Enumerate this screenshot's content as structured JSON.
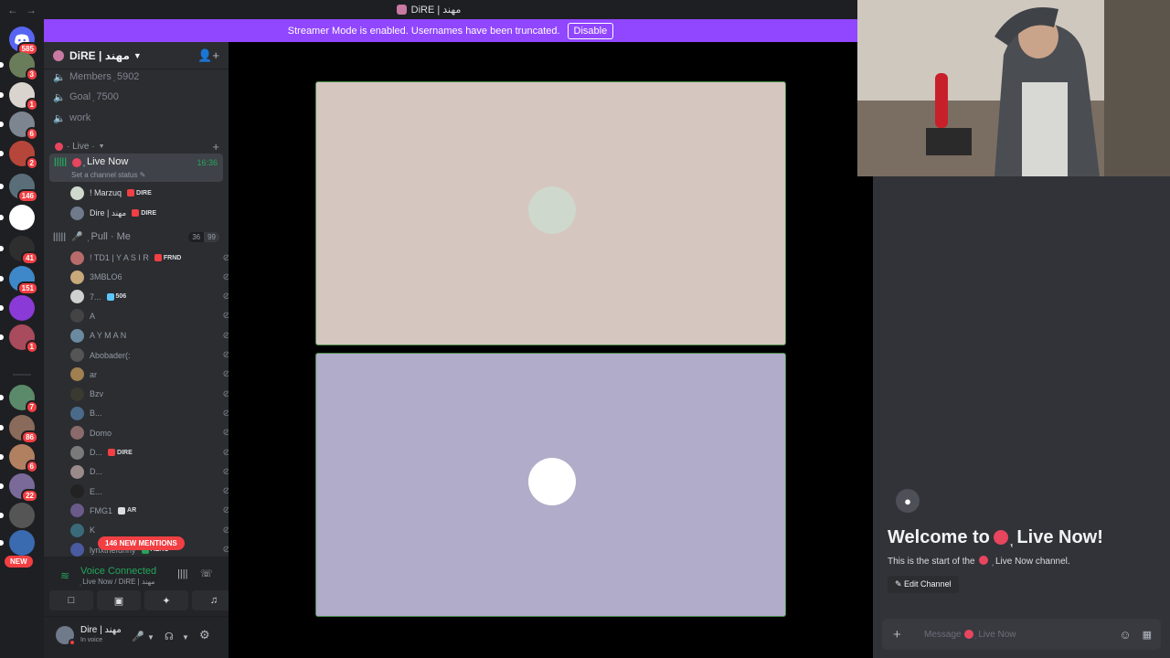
{
  "titlebar": {
    "title": "DiRE | مهند",
    "back": "←",
    "forward": "→"
  },
  "banner": {
    "text": "Streamer Mode is enabled. Usernames have been truncated.",
    "button": "Disable"
  },
  "rail": {
    "home_badge": "585",
    "servers": [
      {
        "badge": "3",
        "color": "#6a7d5a"
      },
      {
        "badge": "1",
        "color": "#d9d4ce"
      },
      {
        "badge": "6",
        "color": "#7c8590"
      },
      {
        "badge": "2",
        "color": "#b6463a"
      },
      {
        "badge": "146",
        "color": "#5a6e7a"
      },
      {
        "badge": "",
        "color": "#ffffff"
      },
      {
        "badge": "41",
        "color": "#2e2e2e"
      },
      {
        "badge": "151",
        "color": "#3e88c9"
      },
      {
        "badge": "",
        "color": "#8a3ad6"
      },
      {
        "badge": "1",
        "color": "#a84b5c"
      },
      {
        "badge": "7",
        "color": "#5a8a6a"
      },
      {
        "badge": "86",
        "color": "#8a6a5a"
      },
      {
        "badge": "6",
        "color": "#b08060"
      },
      {
        "badge": "22",
        "color": "#7a6a9a"
      },
      {
        "badge": "",
        "color": "#555555"
      },
      {
        "badge": "",
        "color": "#3a6ab0"
      }
    ],
    "new_label": "NEW"
  },
  "sidebar": {
    "guild_name": "DiRE | مهند",
    "channels": [
      {
        "label": "Members ᷂ 5902"
      },
      {
        "label": "Goal ᷂ 7500"
      },
      {
        "label": "work"
      }
    ],
    "category": "· Live ·",
    "live_now": {
      "name": "᷂ Live Now",
      "time": "16:36",
      "status": "Set a channel status ✎"
    },
    "live_users": [
      {
        "name": "! Marzuq",
        "tag": "DIRE"
      },
      {
        "name": "Dire | مهند",
        "tag": "DIRE"
      }
    ],
    "pullme": {
      "name": "᷂ Pull · Me",
      "count": "36",
      "limit": "99"
    },
    "pull_users": [
      {
        "name": "! TD1 | Y A S I R",
        "tag": "FRND",
        "tagcolor": "#f23f43",
        "av": "#b96a6a"
      },
      {
        "name": "3MBLO6",
        "tag": "",
        "tagcolor": "",
        "av": "#c9a87a"
      },
      {
        "name": "7...",
        "tag": "506",
        "tagcolor": "#5ac8fa",
        "av": "#d0d0d0"
      },
      {
        "name": "A",
        "tag": "",
        "tagcolor": "",
        "av": "#444444"
      },
      {
        "name": "A Y M A N",
        "tag": "",
        "tagcolor": "",
        "av": "#6a8aa0"
      },
      {
        "name": "Abobader(:",
        "tag": "",
        "tagcolor": "",
        "av": "#555555"
      },
      {
        "name": "ar",
        "tag": "",
        "tagcolor": "",
        "av": "#a08050"
      },
      {
        "name": "Bzv",
        "tag": "",
        "tagcolor": "",
        "av": "#3a3a30"
      },
      {
        "name": "B...",
        "tag": "",
        "tagcolor": "",
        "av": "#4a6a8a"
      },
      {
        "name": "Domo",
        "tag": "",
        "tagcolor": "",
        "av": "#8a6a6a"
      },
      {
        "name": "D...",
        "tag": "DIRE",
        "tagcolor": "#f23f43",
        "av": "#7a7a7a"
      },
      {
        "name": "D...",
        "tag": "",
        "tagcolor": "",
        "av": "#9a8a8a"
      },
      {
        "name": "E...",
        "tag": "",
        "tagcolor": "",
        "av": "#222222"
      },
      {
        "name": "FMG1",
        "tag": "AR",
        "tagcolor": "#dbdee1",
        "av": "#6a5a8a"
      },
      {
        "name": "K",
        "tag": "",
        "tagcolor": "",
        "av": "#3a6a7a"
      },
      {
        "name": "lynxthefunny",
        "tag": "AERO",
        "tagcolor": "#23a55a",
        "av": "#4a5aa0"
      }
    ],
    "mentions": "146 NEW MENTIONS"
  },
  "voice": {
    "connected": "Voice Connected",
    "location": "᷂ Live Now / DiRE | مهند"
  },
  "user": {
    "name": "Dire | مهند",
    "status": "In voice"
  },
  "stage": {
    "tiles": [
      {
        "bg": "#d5c6c0",
        "avatar": "#cfd8cc"
      },
      {
        "bg": "#b0acc9",
        "avatar": "#ffffff"
      }
    ]
  },
  "chat": {
    "welcome": "Welcome to",
    "channel": "᷂ Live Now!",
    "start_prefix": "This is the start of the",
    "start_channel": "᷂ Live Now channel.",
    "edit": "✎ Edit Channel",
    "placeholder_prefix": "Message",
    "placeholder_channel": "᷂ Live Now"
  }
}
